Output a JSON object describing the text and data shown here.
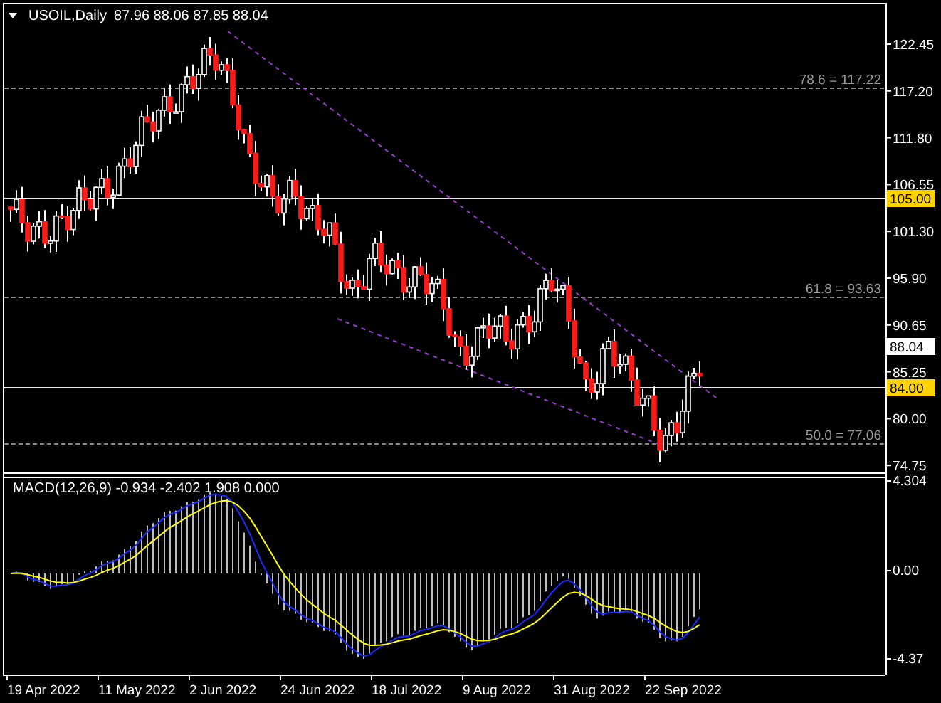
{
  "chart": {
    "symbol": "USOIL,Daily",
    "ohlc": "87.96 88.06 87.85 88.04"
  },
  "price_axis": [
    "122.45",
    "117.20",
    "111.80",
    "106.55",
    "101.30",
    "95.90",
    "90.65",
    "85.25",
    "80.00",
    "74.75"
  ],
  "price_markers": [
    {
      "kind": "level",
      "label": "105.00"
    },
    {
      "kind": "current",
      "label": "88.04"
    },
    {
      "kind": "level",
      "label": "84.00"
    }
  ],
  "fibonacci_levels": [
    "78.6 = 117.22",
    "61.8 = 93.63",
    "50.0 = 77.06"
  ],
  "macd": {
    "label": "MACD(12,26,9) -0.934 -2.402 1.908 0.000",
    "axis": [
      "4.304",
      "0.00",
      "-4.37"
    ]
  },
  "time_axis": [
    "19 Apr 2022",
    "11 May 2022",
    "2 Jun 2022",
    "24 Jun 2022",
    "18 Jul 2022",
    "9 Aug 2022",
    "31 Aug 2022",
    "22 Sep 2022"
  ]
}
